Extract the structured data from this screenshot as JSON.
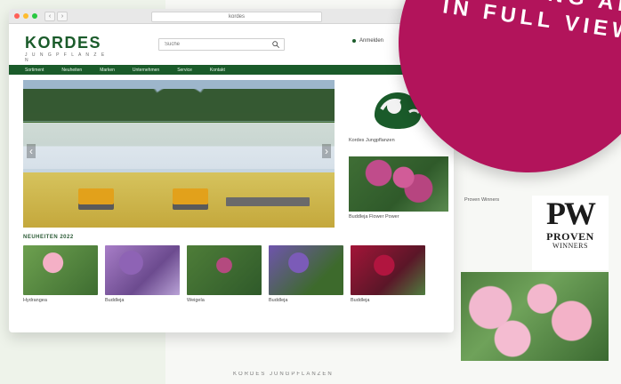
{
  "promo": {
    "text": "ANYTHING ALL IN FULL VIEW."
  },
  "browser": {
    "url_text": "kordes"
  },
  "site": {
    "brand": "KORDES",
    "tagline": "J U N G P F L A N Z E N",
    "search_placeholder": "Suche",
    "account_text": "Anmelden"
  },
  "nav": {
    "items": [
      "Sortiment",
      "Neuheiten",
      "Marken",
      "Unternehmen",
      "Service",
      "Kontakt"
    ]
  },
  "right_tiles": [
    {
      "caption": "Kordes Jungpflanzen"
    },
    {
      "caption": "Buddleja Flower Power"
    }
  ],
  "sections": {
    "new_products_title": "NEUHEITEN 2022"
  },
  "products": [
    {
      "caption": "Hydrangea"
    },
    {
      "caption": "Buddleja"
    },
    {
      "caption": "Weigela"
    },
    {
      "caption": "Buddleja"
    },
    {
      "caption": "Buddleja"
    }
  ],
  "background": {
    "right_text": "Proven Winners",
    "footer_text": "KORDES JUNGPFLANZEN"
  },
  "pw_logo": {
    "main": "PW",
    "sub": "PROVEN",
    "sub2": "WINNERS"
  },
  "colors": {
    "brand_green": "#1a5b2a",
    "badge_magenta": "#b2145b"
  }
}
